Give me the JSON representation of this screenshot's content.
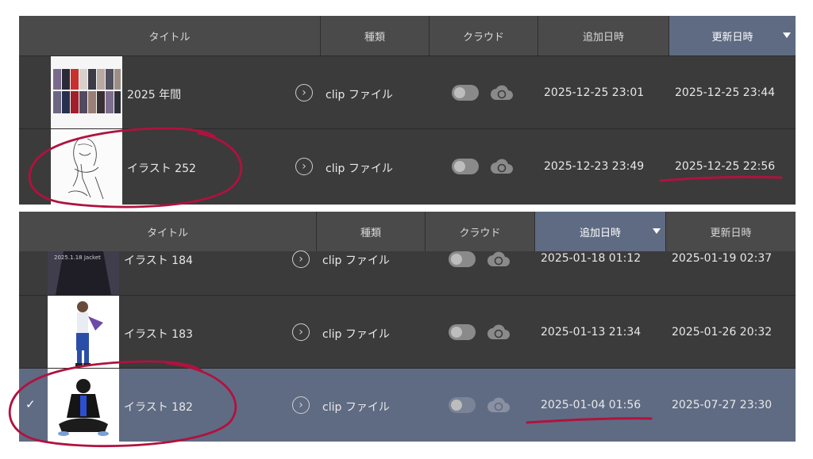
{
  "columns": {
    "title": "タイトル",
    "kind": "種類",
    "cloud": "クラウド",
    "added": "追加日時",
    "updated": "更新日時"
  },
  "top_panel": {
    "sorted_column": "更新日時",
    "rows": [
      {
        "title": "2025 年間",
        "kind": "clip ファイル",
        "added": "2025-12-25 23:01",
        "updated": "2025-12-25 23:44",
        "cloud_sync": false,
        "selected": false
      },
      {
        "title": "イラスト 252",
        "kind": "clip ファイル",
        "added": "2025-12-23 23:49",
        "updated": "2025-12-25 22:56",
        "cloud_sync": false,
        "selected": false
      }
    ]
  },
  "bottom_panel": {
    "sorted_column": "追加日時",
    "rows": [
      {
        "title": "イラスト 184",
        "kind": "clip ファイル",
        "added": "2025-01-18 01:12",
        "updated": "2025-01-19 02:37",
        "cloud_sync": false,
        "selected": false
      },
      {
        "title": "イラスト 183",
        "kind": "clip ファイル",
        "added": "2025-01-13 21:34",
        "updated": "2025-01-26 20:32",
        "cloud_sync": false,
        "selected": false
      },
      {
        "title": "イラスト 182",
        "kind": "clip ファイル",
        "added": "2025-01-04 01:56",
        "updated": "2025-07-27 23:30",
        "cloud_sync": false,
        "selected": true
      }
    ]
  },
  "check_mark": "✓",
  "chevron_glyph": "›",
  "colors": {
    "panel_bg": "#3b3b3b",
    "header_bg": "#4a4a4a",
    "active_header": "#5f6b83",
    "selected_row": "#5f6b83",
    "annotation": "#b0123f"
  }
}
